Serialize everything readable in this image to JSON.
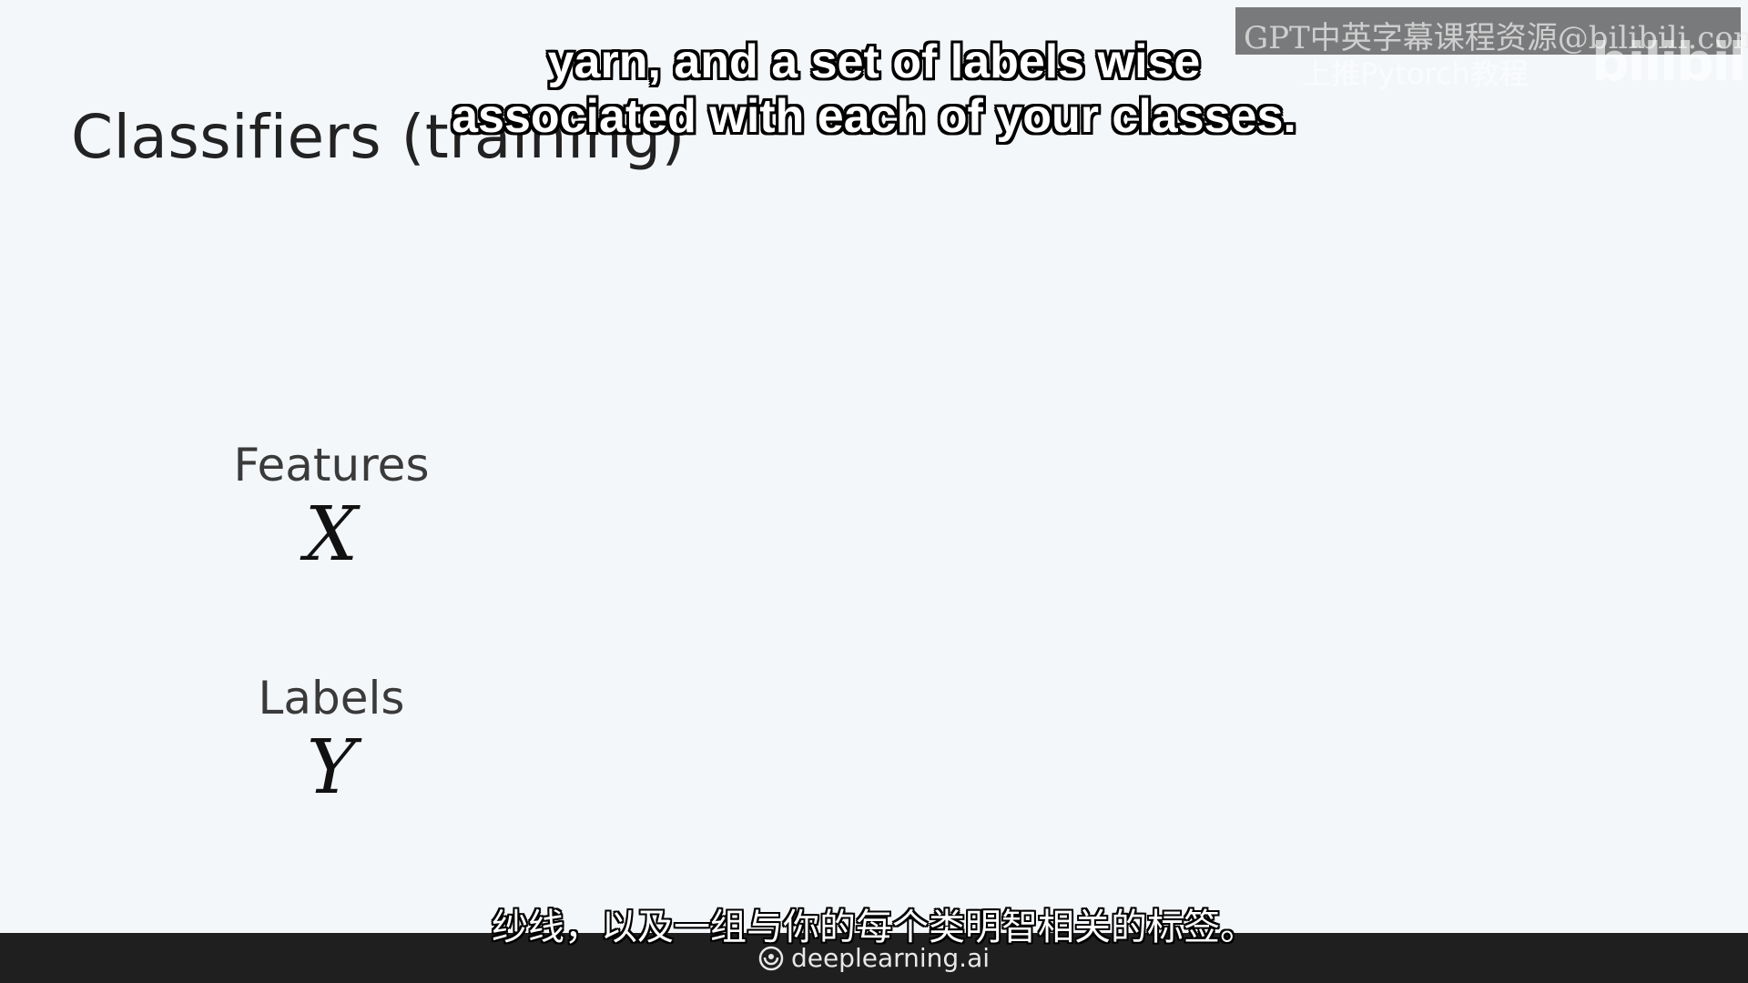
{
  "slide": {
    "title": "Classifiers (training)",
    "features": {
      "label": "Features",
      "symbol": "X"
    },
    "labels": {
      "label": "Labels",
      "symbol": "Y"
    }
  },
  "subtitles": {
    "english_line1": "yarn, and a set of labels wise",
    "english_line2": "associated with each of your classes.",
    "chinese": "纱线，以及一组与你的每个类明智相关的标签。"
  },
  "watermark": {
    "text": "GPT中英字幕课程资源@bilibili.com",
    "subtext": "上推Pytorch教程",
    "logo": "bilibili"
  },
  "footer": {
    "brand": "deeplearning.ai",
    "brand_icon": "deeplearning-logo-icon"
  },
  "colors": {
    "background": "#f4f7fa",
    "footer": "#1f1f1f"
  }
}
